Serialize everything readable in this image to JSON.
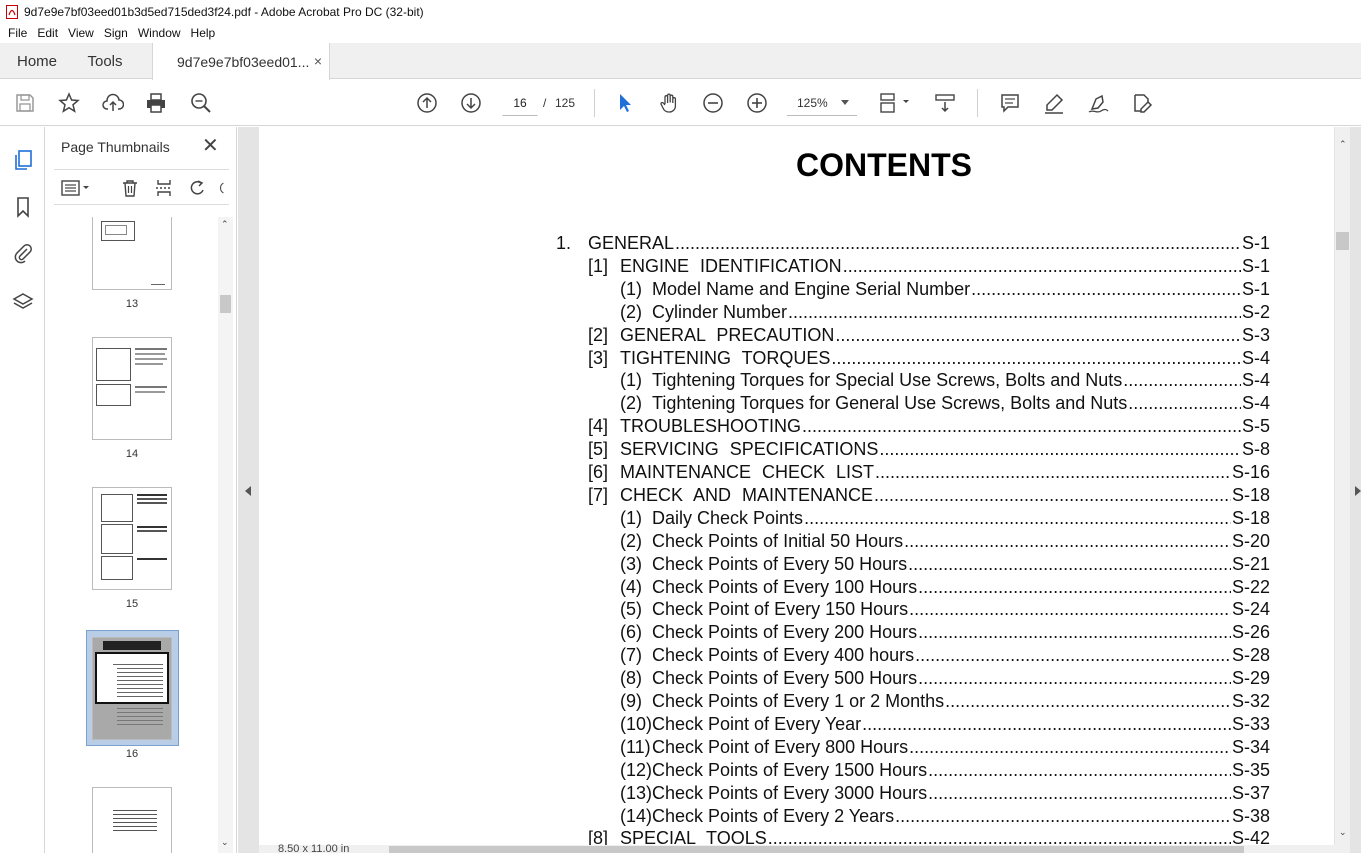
{
  "window": {
    "title": "9d7e9e7bf03eed01b3d5ed715ded3f24.pdf - Adobe Acrobat Pro DC (32-bit)"
  },
  "menu": [
    "File",
    "Edit",
    "View",
    "Sign",
    "Window",
    "Help"
  ],
  "tabs": {
    "home": "Home",
    "tools": "Tools",
    "document": "9d7e9e7bf03eed01...",
    "close": "×"
  },
  "toolbar": {
    "page_current": "16",
    "page_sep": "/",
    "page_total": "125",
    "zoom": "125%"
  },
  "thumbnails": {
    "title": "Page Thumbnails",
    "close": "✕",
    "pages": [
      "13",
      "14",
      "15",
      "16"
    ],
    "selected": "16"
  },
  "status": {
    "page_size": "8.50 x 11.00 in"
  },
  "document": {
    "heading": "CONTENTS",
    "toc": [
      {
        "num": "1.",
        "text": "GENERAL",
        "page": "S-1",
        "level": 0
      },
      {
        "num": "[1]",
        "text": "ENGINE IDENTIFICATION",
        "page": "S-1",
        "level": 1
      },
      {
        "num": "(1)",
        "text": "Model Name and Engine Serial Number",
        "page": "S-1",
        "level": 2
      },
      {
        "num": "(2)",
        "text": "Cylinder Number",
        "page": "S-2",
        "level": 2
      },
      {
        "num": "[2]",
        "text": "GENERAL PRECAUTION",
        "page": "S-3",
        "level": 1
      },
      {
        "num": "[3]",
        "text": "TIGHTENING TORQUES",
        "page": "S-4",
        "level": 1
      },
      {
        "num": "(1)",
        "text": "Tightening Torques for Special Use Screws, Bolts and Nuts",
        "page": "S-4",
        "level": 2
      },
      {
        "num": "(2)",
        "text": "Tightening Torques for General Use Screws, Bolts and Nuts",
        "page": "S-4",
        "level": 2
      },
      {
        "num": "[4]",
        "text": "TROUBLESHOOTING",
        "page": "S-5",
        "level": 1
      },
      {
        "num": "[5]",
        "text": "SERVICING SPECIFICATIONS",
        "page": "S-8",
        "level": 1
      },
      {
        "num": "[6]",
        "text": "MAINTENANCE CHECK LIST",
        "page": "S-16",
        "level": 1
      },
      {
        "num": "[7]",
        "text": "CHECK AND MAINTENANCE",
        "page": "S-18",
        "level": 1
      },
      {
        "num": "(1)",
        "text": "Daily Check Points",
        "page": "S-18",
        "level": 2
      },
      {
        "num": "(2)",
        "text": "Check Points of Initial 50 Hours",
        "page": "S-20",
        "level": 2
      },
      {
        "num": "(3)",
        "text": "Check Points of Every 50 Hours",
        "page": "S-21",
        "level": 2
      },
      {
        "num": "(4)",
        "text": "Check Points of Every 100 Hours",
        "page": "S-22",
        "level": 2
      },
      {
        "num": "(5)",
        "text": "Check Point of Every 150 Hours",
        "page": "S-24",
        "level": 2
      },
      {
        "num": "(6)",
        "text": "Check Points of Every 200 Hours",
        "page": "S-26",
        "level": 2
      },
      {
        "num": "(7)",
        "text": "Check Points of Every 400 hours",
        "page": "S-28",
        "level": 2
      },
      {
        "num": "(8)",
        "text": "Check Points of Every 500 Hours",
        "page": "S-29",
        "level": 2
      },
      {
        "num": "(9)",
        "text": "Check Points of Every 1 or 2 Months",
        "page": "S-32",
        "level": 2
      },
      {
        "num": "(10)",
        "text": "Check Point of Every Year",
        "page": "S-33",
        "level": 2
      },
      {
        "num": "(11)",
        "text": "Check Point of Every 800 Hours",
        "page": "S-34",
        "level": 2
      },
      {
        "num": "(12)",
        "text": "Check Points of Every 1500 Hours",
        "page": "S-35",
        "level": 2
      },
      {
        "num": "(13)",
        "text": "Check Points of Every 3000 Hours",
        "page": "S-37",
        "level": 2
      },
      {
        "num": "(14)",
        "text": "Check Points of Every 2 Years",
        "page": "S-38",
        "level": 2
      },
      {
        "num": "[8]",
        "text": "SPECIAL TOOLS",
        "page": "S-42",
        "level": 1
      }
    ]
  }
}
